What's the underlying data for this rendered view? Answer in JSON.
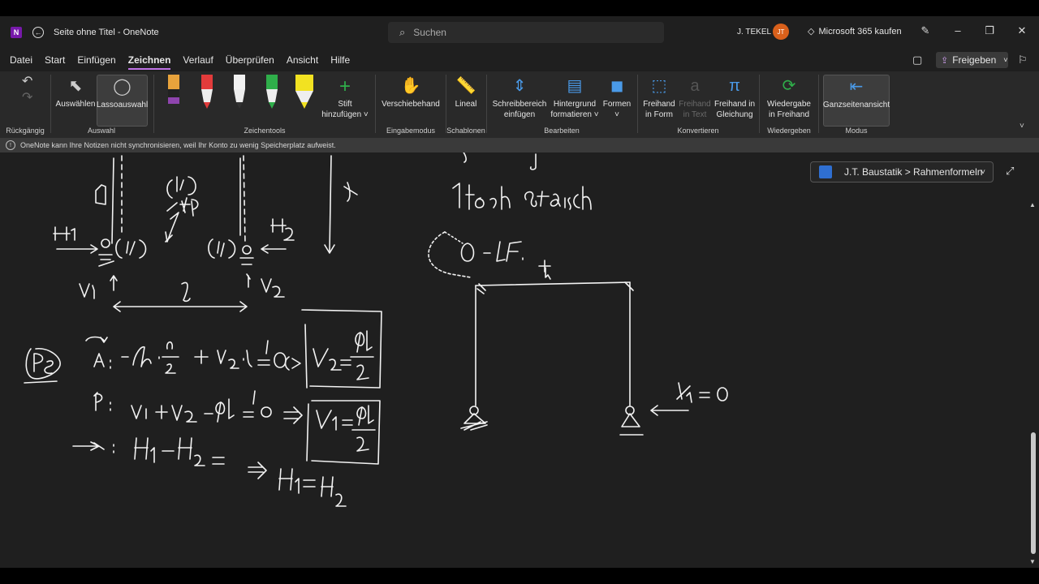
{
  "window": {
    "title": "Seite ohne Titel - OneNote",
    "app_icon_letter": "N",
    "search_placeholder": "Suchen",
    "user_name": "J. TEKEL",
    "user_initials": "JT",
    "buy_label": "Microsoft 365 kaufen"
  },
  "menu": {
    "items": [
      "Datei",
      "Start",
      "Einfügen",
      "Zeichnen",
      "Verlauf",
      "Überprüfen",
      "Ansicht",
      "Hilfe"
    ],
    "active": "Zeichnen",
    "share_label": "Freigeben"
  },
  "ribbon": {
    "undo_group_label": "Rückgängig",
    "select_label": "Auswählen",
    "lasso_label": "Lassoauswahl",
    "selection_group_label": "Auswahl",
    "pens": [
      {
        "color": "#e8a33c",
        "band": "#8e44ad"
      },
      {
        "color": "#e23b3b",
        "band": "#e23b3b"
      },
      {
        "color": "#f2f2f2",
        "band": "#f2f2f2"
      },
      {
        "color": "#2fae4a",
        "band": "#2fae4a"
      },
      {
        "color": "#f2e221",
        "band": "#f2e221"
      }
    ],
    "add_pen_label_1": "Stift",
    "add_pen_label_2": "hinzufügen ˅",
    "drawing_tools_label": "Zeichentools",
    "touch_label": "Verschiebehand",
    "input_mode_label": "Eingabemodus",
    "ruler_label": "Lineal",
    "templates_label": "Schablonen",
    "insert_space_1": "Schreibbereich",
    "insert_space_2": "einfügen",
    "background_1": "Hintergrund",
    "background_2": "formatieren ˅",
    "shapes_1": "Formen",
    "shapes_2": "˅",
    "edit_label": "Bearbeiten",
    "ink_to_shape_1": "Freihand",
    "ink_to_shape_2": "in Form",
    "ink_to_text_1": "Freihand",
    "ink_to_text_2": "in Text",
    "ink_to_math_1": "Freihand in",
    "ink_to_math_2": "Gleichung",
    "convert_label": "Konvertieren",
    "replay_1": "Wiedergabe",
    "replay_2": "in Freihand",
    "replay_group_label": "Wiedergeben",
    "fullpage_label": "Ganzseitenansicht",
    "mode_label": "Modus"
  },
  "notification": "OneNote kann Ihre Notizen nicht synchronisieren, weil Ihr Konto zu wenig Speicherplatz aufweist.",
  "notebook": {
    "path": "J.T. Baustatik > Rahmenformeln"
  },
  "icons": {
    "undo": "undo-icon",
    "redo": "redo-icon",
    "select": "cursor-icon",
    "lasso": "lasso-icon",
    "add_pen": "plus-icon",
    "touch": "hand-icon",
    "ruler": "ruler-icon",
    "insert_space": "insert-space-icon",
    "background": "grid-lines-icon",
    "shapes": "shapes-icon",
    "ink_shape": "ink-to-shape-icon",
    "ink_text": "ink-to-text-icon",
    "ink_math": "ink-to-math-icon",
    "replay": "replay-icon",
    "fullpage": "fullpage-icon"
  },
  "colors": {
    "accent": "#c073e6",
    "canvas": "#1f1f1f",
    "ribbon": "#292929",
    "ink": "#f2f2f2"
  }
}
